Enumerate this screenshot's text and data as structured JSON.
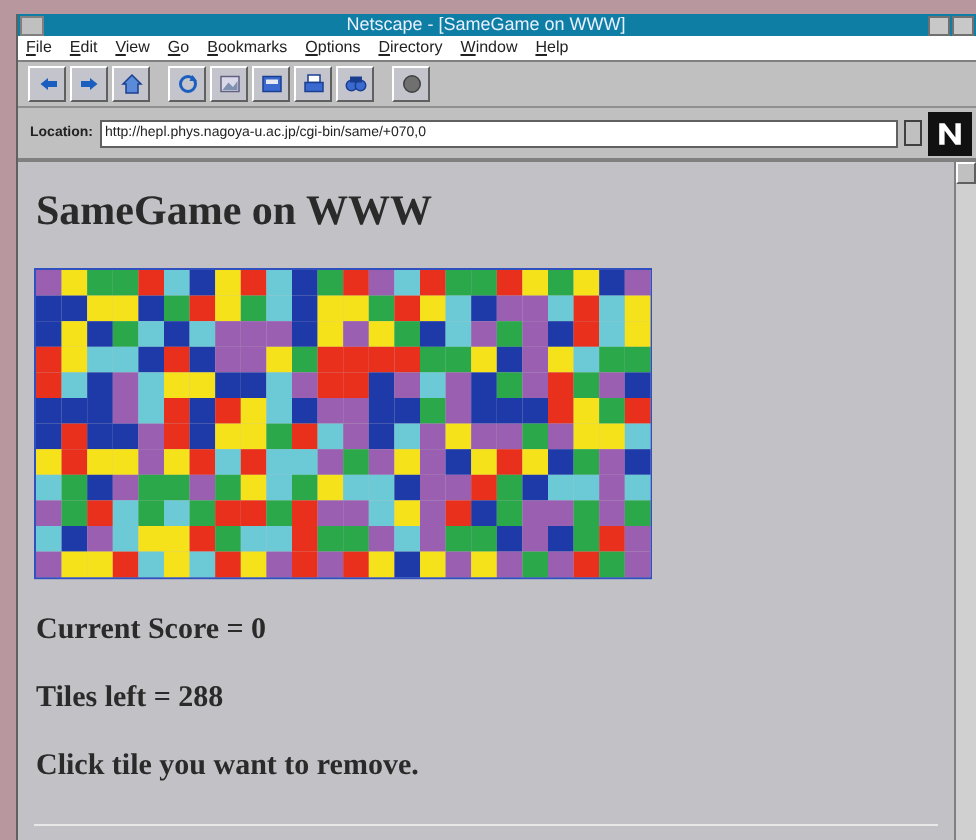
{
  "window": {
    "title": "Netscape - [SameGame on WWW]"
  },
  "menu": [
    "File",
    "Edit",
    "View",
    "Go",
    "Bookmarks",
    "Options",
    "Directory",
    "Window",
    "Help"
  ],
  "toolbar": [
    {
      "buttons": [
        {
          "kind": "back"
        },
        {
          "kind": "forward"
        },
        {
          "kind": "home"
        }
      ]
    },
    {
      "buttons": [
        {
          "kind": "reload"
        },
        {
          "kind": "images"
        },
        {
          "kind": "open"
        },
        {
          "kind": "print"
        },
        {
          "kind": "find"
        }
      ]
    },
    {
      "buttons": [
        {
          "kind": "stop"
        }
      ]
    }
  ],
  "location": {
    "label": "Location:",
    "value": "http://hepl.phys.nagoya-u.ac.jp/cgi-bin/same/+070,0"
  },
  "page": {
    "heading": "SameGame on WWW",
    "board": {
      "rows": [
        {
          "tiles": [
            {
              "color": "#9a5fb0"
            },
            {
              "color": "#f6e21a"
            },
            {
              "color": "#2aa84a"
            },
            {
              "color": "#2aa84a"
            },
            {
              "color": "#e8301c"
            },
            {
              "color": "#6ccad6"
            },
            {
              "color": "#1e3aa8"
            },
            {
              "color": "#f6e21a"
            },
            {
              "color": "#e8301c"
            },
            {
              "color": "#6ccad6"
            },
            {
              "color": "#1e3aa8"
            },
            {
              "color": "#2aa84a"
            },
            {
              "color": "#e8301c"
            },
            {
              "color": "#9a5fb0"
            },
            {
              "color": "#6ccad6"
            },
            {
              "color": "#e8301c"
            },
            {
              "color": "#2aa84a"
            },
            {
              "color": "#2aa84a"
            },
            {
              "color": "#e8301c"
            },
            {
              "color": "#f6e21a"
            },
            {
              "color": "#2aa84a"
            },
            {
              "color": "#f6e21a"
            },
            {
              "color": "#1e3aa8"
            },
            {
              "color": "#9a5fb0"
            }
          ]
        },
        {
          "tiles": [
            {
              "color": "#1e3aa8"
            },
            {
              "color": "#1e3aa8"
            },
            {
              "color": "#f6e21a"
            },
            {
              "color": "#f6e21a"
            },
            {
              "color": "#1e3aa8"
            },
            {
              "color": "#2aa84a"
            },
            {
              "color": "#e8301c"
            },
            {
              "color": "#f6e21a"
            },
            {
              "color": "#2aa84a"
            },
            {
              "color": "#6ccad6"
            },
            {
              "color": "#1e3aa8"
            },
            {
              "color": "#f6e21a"
            },
            {
              "color": "#f6e21a"
            },
            {
              "color": "#2aa84a"
            },
            {
              "color": "#e8301c"
            },
            {
              "color": "#f6e21a"
            },
            {
              "color": "#6ccad6"
            },
            {
              "color": "#1e3aa8"
            },
            {
              "color": "#9a5fb0"
            },
            {
              "color": "#9a5fb0"
            },
            {
              "color": "#6ccad6"
            },
            {
              "color": "#e8301c"
            },
            {
              "color": "#6ccad6"
            },
            {
              "color": "#f6e21a"
            }
          ]
        },
        {
          "tiles": [
            {
              "color": "#1e3aa8"
            },
            {
              "color": "#f6e21a"
            },
            {
              "color": "#1e3aa8"
            },
            {
              "color": "#2aa84a"
            },
            {
              "color": "#6ccad6"
            },
            {
              "color": "#1e3aa8"
            },
            {
              "color": "#6ccad6"
            },
            {
              "color": "#9a5fb0"
            },
            {
              "color": "#9a5fb0"
            },
            {
              "color": "#9a5fb0"
            },
            {
              "color": "#1e3aa8"
            },
            {
              "color": "#f6e21a"
            },
            {
              "color": "#9a5fb0"
            },
            {
              "color": "#f6e21a"
            },
            {
              "color": "#2aa84a"
            },
            {
              "color": "#1e3aa8"
            },
            {
              "color": "#6ccad6"
            },
            {
              "color": "#9a5fb0"
            },
            {
              "color": "#2aa84a"
            },
            {
              "color": "#9a5fb0"
            },
            {
              "color": "#1e3aa8"
            },
            {
              "color": "#e8301c"
            },
            {
              "color": "#6ccad6"
            },
            {
              "color": "#f6e21a"
            }
          ]
        },
        {
          "tiles": [
            {
              "color": "#e8301c"
            },
            {
              "color": "#f6e21a"
            },
            {
              "color": "#6ccad6"
            },
            {
              "color": "#6ccad6"
            },
            {
              "color": "#1e3aa8"
            },
            {
              "color": "#e8301c"
            },
            {
              "color": "#1e3aa8"
            },
            {
              "color": "#9a5fb0"
            },
            {
              "color": "#9a5fb0"
            },
            {
              "color": "#f6e21a"
            },
            {
              "color": "#2aa84a"
            },
            {
              "color": "#e8301c"
            },
            {
              "color": "#e8301c"
            },
            {
              "color": "#e8301c"
            },
            {
              "color": "#e8301c"
            },
            {
              "color": "#2aa84a"
            },
            {
              "color": "#2aa84a"
            },
            {
              "color": "#f6e21a"
            },
            {
              "color": "#1e3aa8"
            },
            {
              "color": "#9a5fb0"
            },
            {
              "color": "#f6e21a"
            },
            {
              "color": "#6ccad6"
            },
            {
              "color": "#2aa84a"
            },
            {
              "color": "#2aa84a"
            }
          ]
        },
        {
          "tiles": [
            {
              "color": "#e8301c"
            },
            {
              "color": "#6ccad6"
            },
            {
              "color": "#1e3aa8"
            },
            {
              "color": "#9a5fb0"
            },
            {
              "color": "#6ccad6"
            },
            {
              "color": "#f6e21a"
            },
            {
              "color": "#f6e21a"
            },
            {
              "color": "#1e3aa8"
            },
            {
              "color": "#1e3aa8"
            },
            {
              "color": "#6ccad6"
            },
            {
              "color": "#9a5fb0"
            },
            {
              "color": "#e8301c"
            },
            {
              "color": "#e8301c"
            },
            {
              "color": "#1e3aa8"
            },
            {
              "color": "#9a5fb0"
            },
            {
              "color": "#6ccad6"
            },
            {
              "color": "#9a5fb0"
            },
            {
              "color": "#1e3aa8"
            },
            {
              "color": "#2aa84a"
            },
            {
              "color": "#9a5fb0"
            },
            {
              "color": "#e8301c"
            },
            {
              "color": "#2aa84a"
            },
            {
              "color": "#9a5fb0"
            },
            {
              "color": "#1e3aa8"
            }
          ]
        },
        {
          "tiles": [
            {
              "color": "#1e3aa8"
            },
            {
              "color": "#1e3aa8"
            },
            {
              "color": "#1e3aa8"
            },
            {
              "color": "#9a5fb0"
            },
            {
              "color": "#6ccad6"
            },
            {
              "color": "#e8301c"
            },
            {
              "color": "#1e3aa8"
            },
            {
              "color": "#e8301c"
            },
            {
              "color": "#f6e21a"
            },
            {
              "color": "#6ccad6"
            },
            {
              "color": "#1e3aa8"
            },
            {
              "color": "#9a5fb0"
            },
            {
              "color": "#9a5fb0"
            },
            {
              "color": "#1e3aa8"
            },
            {
              "color": "#1e3aa8"
            },
            {
              "color": "#2aa84a"
            },
            {
              "color": "#9a5fb0"
            },
            {
              "color": "#1e3aa8"
            },
            {
              "color": "#1e3aa8"
            },
            {
              "color": "#1e3aa8"
            },
            {
              "color": "#e8301c"
            },
            {
              "color": "#f6e21a"
            },
            {
              "color": "#2aa84a"
            },
            {
              "color": "#e8301c"
            }
          ]
        },
        {
          "tiles": [
            {
              "color": "#1e3aa8"
            },
            {
              "color": "#e8301c"
            },
            {
              "color": "#1e3aa8"
            },
            {
              "color": "#1e3aa8"
            },
            {
              "color": "#9a5fb0"
            },
            {
              "color": "#e8301c"
            },
            {
              "color": "#1e3aa8"
            },
            {
              "color": "#f6e21a"
            },
            {
              "color": "#f6e21a"
            },
            {
              "color": "#2aa84a"
            },
            {
              "color": "#e8301c"
            },
            {
              "color": "#6ccad6"
            },
            {
              "color": "#9a5fb0"
            },
            {
              "color": "#1e3aa8"
            },
            {
              "color": "#6ccad6"
            },
            {
              "color": "#9a5fb0"
            },
            {
              "color": "#f6e21a"
            },
            {
              "color": "#9a5fb0"
            },
            {
              "color": "#9a5fb0"
            },
            {
              "color": "#2aa84a"
            },
            {
              "color": "#9a5fb0"
            },
            {
              "color": "#f6e21a"
            },
            {
              "color": "#f6e21a"
            },
            {
              "color": "#6ccad6"
            }
          ]
        },
        {
          "tiles": [
            {
              "color": "#f6e21a"
            },
            {
              "color": "#e8301c"
            },
            {
              "color": "#f6e21a"
            },
            {
              "color": "#f6e21a"
            },
            {
              "color": "#9a5fb0"
            },
            {
              "color": "#f6e21a"
            },
            {
              "color": "#e8301c"
            },
            {
              "color": "#6ccad6"
            },
            {
              "color": "#e8301c"
            },
            {
              "color": "#6ccad6"
            },
            {
              "color": "#6ccad6"
            },
            {
              "color": "#9a5fb0"
            },
            {
              "color": "#2aa84a"
            },
            {
              "color": "#9a5fb0"
            },
            {
              "color": "#f6e21a"
            },
            {
              "color": "#9a5fb0"
            },
            {
              "color": "#1e3aa8"
            },
            {
              "color": "#f6e21a"
            },
            {
              "color": "#e8301c"
            },
            {
              "color": "#f6e21a"
            },
            {
              "color": "#1e3aa8"
            },
            {
              "color": "#2aa84a"
            },
            {
              "color": "#9a5fb0"
            },
            {
              "color": "#1e3aa8"
            }
          ]
        },
        {
          "tiles": [
            {
              "color": "#6ccad6"
            },
            {
              "color": "#2aa84a"
            },
            {
              "color": "#1e3aa8"
            },
            {
              "color": "#9a5fb0"
            },
            {
              "color": "#2aa84a"
            },
            {
              "color": "#2aa84a"
            },
            {
              "color": "#9a5fb0"
            },
            {
              "color": "#2aa84a"
            },
            {
              "color": "#f6e21a"
            },
            {
              "color": "#6ccad6"
            },
            {
              "color": "#2aa84a"
            },
            {
              "color": "#f6e21a"
            },
            {
              "color": "#6ccad6"
            },
            {
              "color": "#6ccad6"
            },
            {
              "color": "#1e3aa8"
            },
            {
              "color": "#9a5fb0"
            },
            {
              "color": "#9a5fb0"
            },
            {
              "color": "#e8301c"
            },
            {
              "color": "#2aa84a"
            },
            {
              "color": "#1e3aa8"
            },
            {
              "color": "#6ccad6"
            },
            {
              "color": "#6ccad6"
            },
            {
              "color": "#9a5fb0"
            },
            {
              "color": "#6ccad6"
            }
          ]
        },
        {
          "tiles": [
            {
              "color": "#9a5fb0"
            },
            {
              "color": "#2aa84a"
            },
            {
              "color": "#e8301c"
            },
            {
              "color": "#6ccad6"
            },
            {
              "color": "#2aa84a"
            },
            {
              "color": "#6ccad6"
            },
            {
              "color": "#2aa84a"
            },
            {
              "color": "#e8301c"
            },
            {
              "color": "#e8301c"
            },
            {
              "color": "#2aa84a"
            },
            {
              "color": "#e8301c"
            },
            {
              "color": "#9a5fb0"
            },
            {
              "color": "#9a5fb0"
            },
            {
              "color": "#6ccad6"
            },
            {
              "color": "#f6e21a"
            },
            {
              "color": "#9a5fb0"
            },
            {
              "color": "#e8301c"
            },
            {
              "color": "#1e3aa8"
            },
            {
              "color": "#2aa84a"
            },
            {
              "color": "#9a5fb0"
            },
            {
              "color": "#9a5fb0"
            },
            {
              "color": "#2aa84a"
            },
            {
              "color": "#9a5fb0"
            },
            {
              "color": "#2aa84a"
            }
          ]
        },
        {
          "tiles": [
            {
              "color": "#6ccad6"
            },
            {
              "color": "#1e3aa8"
            },
            {
              "color": "#9a5fb0"
            },
            {
              "color": "#6ccad6"
            },
            {
              "color": "#f6e21a"
            },
            {
              "color": "#f6e21a"
            },
            {
              "color": "#e8301c"
            },
            {
              "color": "#2aa84a"
            },
            {
              "color": "#6ccad6"
            },
            {
              "color": "#6ccad6"
            },
            {
              "color": "#e8301c"
            },
            {
              "color": "#2aa84a"
            },
            {
              "color": "#2aa84a"
            },
            {
              "color": "#9a5fb0"
            },
            {
              "color": "#6ccad6"
            },
            {
              "color": "#9a5fb0"
            },
            {
              "color": "#2aa84a"
            },
            {
              "color": "#2aa84a"
            },
            {
              "color": "#1e3aa8"
            },
            {
              "color": "#9a5fb0"
            },
            {
              "color": "#1e3aa8"
            },
            {
              "color": "#2aa84a"
            },
            {
              "color": "#e8301c"
            },
            {
              "color": "#9a5fb0"
            }
          ]
        },
        {
          "tiles": [
            {
              "color": "#9a5fb0"
            },
            {
              "color": "#f6e21a"
            },
            {
              "color": "#f6e21a"
            },
            {
              "color": "#e8301c"
            },
            {
              "color": "#6ccad6"
            },
            {
              "color": "#f6e21a"
            },
            {
              "color": "#6ccad6"
            },
            {
              "color": "#e8301c"
            },
            {
              "color": "#f6e21a"
            },
            {
              "color": "#9a5fb0"
            },
            {
              "color": "#e8301c"
            },
            {
              "color": "#9a5fb0"
            },
            {
              "color": "#e8301c"
            },
            {
              "color": "#f6e21a"
            },
            {
              "color": "#1e3aa8"
            },
            {
              "color": "#f6e21a"
            },
            {
              "color": "#9a5fb0"
            },
            {
              "color": "#f6e21a"
            },
            {
              "color": "#9a5fb0"
            },
            {
              "color": "#2aa84a"
            },
            {
              "color": "#9a5fb0"
            },
            {
              "color": "#e8301c"
            },
            {
              "color": "#2aa84a"
            },
            {
              "color": "#9a5fb0"
            }
          ]
        }
      ]
    },
    "lines": [
      "Current Score = 0",
      "Tiles left = 288",
      "Click tile you want to remove."
    ]
  }
}
